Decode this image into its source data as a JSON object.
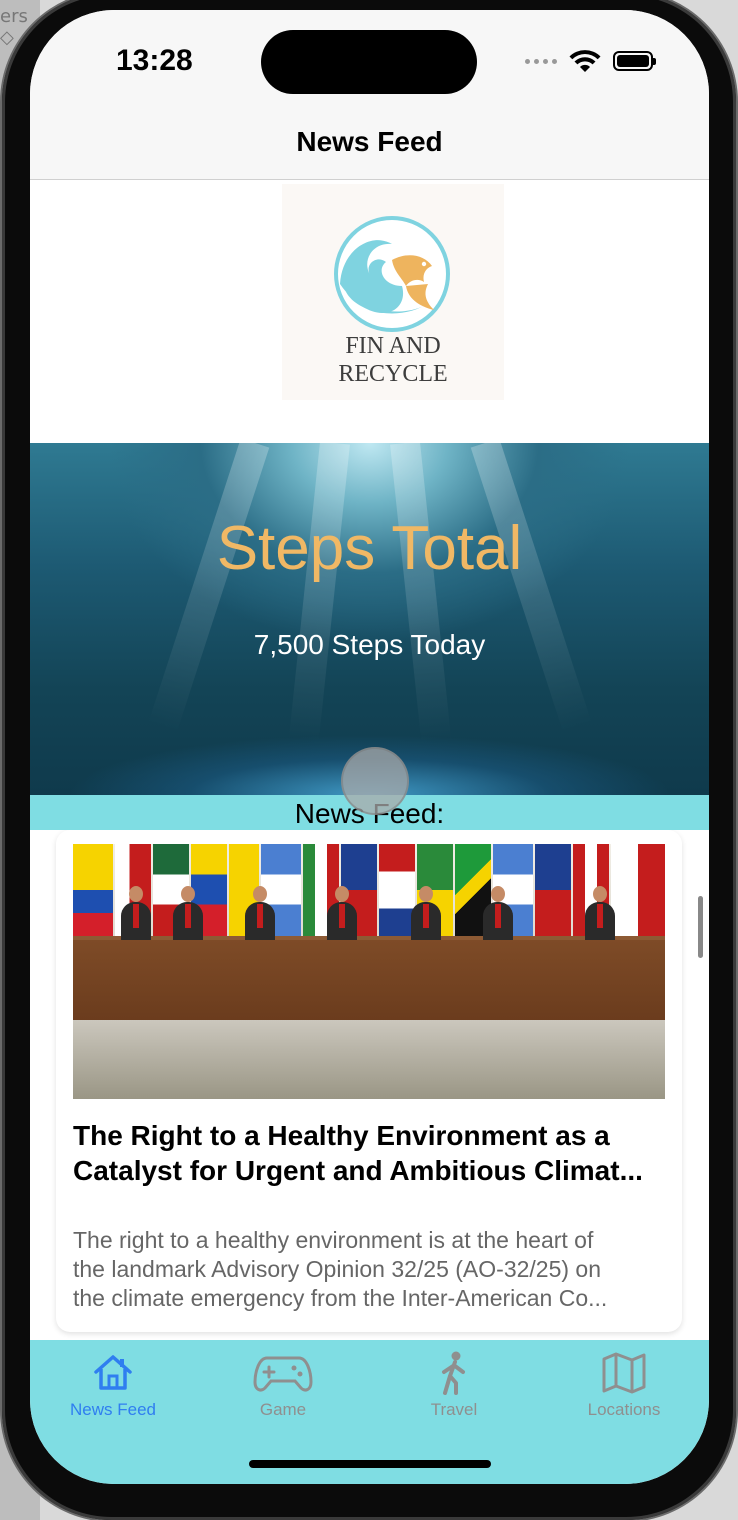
{
  "status_bar": {
    "time": "13:28"
  },
  "nav": {
    "title": "News Feed"
  },
  "logo": {
    "line1": "FIN AND",
    "line2": "RECYCLE"
  },
  "hero": {
    "title": "Steps Total",
    "subtitle": "7,500 Steps Today"
  },
  "section": {
    "label": "News Feed:"
  },
  "article": {
    "title_lines": [
      "The Right to a Healthy Environment as a",
      "Catalyst for Urgent and Ambitious Climat..."
    ],
    "body_lines": [
      "The right to a healthy environment is at the heart of",
      "the landmark Advisory Opinion 32/25 (AO-32/25) on",
      "the climate emergency from the Inter-American Co..."
    ]
  },
  "tabs": [
    {
      "label": "News Feed",
      "icon": "house-icon",
      "active": true
    },
    {
      "label": "Game",
      "icon": "gamecontroller-icon",
      "active": false
    },
    {
      "label": "Travel",
      "icon": "walking-figure-icon",
      "active": false
    },
    {
      "label": "Locations",
      "icon": "map-icon",
      "active": false
    }
  ],
  "colors": {
    "accent": "#2f7ef0",
    "tabbar": "#7fdde3",
    "hero_title": "#f0b865"
  }
}
